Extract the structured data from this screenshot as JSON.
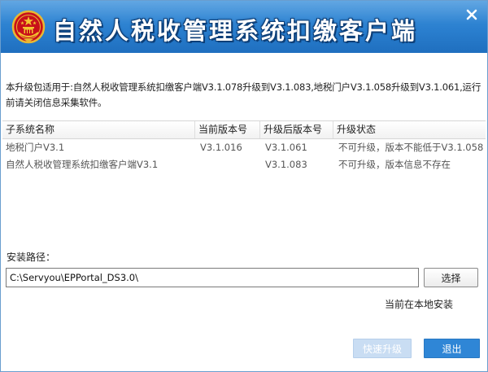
{
  "window": {
    "title": "自然人税收管理系统扣缴客户端",
    "close_symbol": "✕"
  },
  "description": "本升级包适用于:自然人税收管理系统扣缴客户端V3.1.078升级到V3.1.083,地税门户V3.1.058升级到V3.1.061,运行前请关闭信息采集软件。",
  "table": {
    "headers": [
      "子系统名称",
      "当前版本号",
      "升级后版本号",
      "升级状态"
    ],
    "rows": [
      {
        "name": "地税门户V3.1",
        "current": "V3.1.016",
        "target": "V3.1.061",
        "status": "不可升级，版本不能低于V3.1.058"
      },
      {
        "name": "自然人税收管理系统扣缴客户端V3.1",
        "current": "",
        "target": "V3.1.083",
        "status": "不可升级，版本信息不存在"
      }
    ]
  },
  "install": {
    "label": "安装路径：",
    "path_value": "C:\\Servyou\\EPPortal_DS3.0\\",
    "browse_label": "选择",
    "status_text": "当前在本地安装"
  },
  "buttons": {
    "upgrade_label": "快速升级",
    "exit_label": "退出"
  },
  "icons": {
    "emblem": "national-emblem-icon",
    "close": "close-icon"
  },
  "colors": {
    "title_bar": "#2a7fcf",
    "primary_button": "#2f86d6",
    "disabled_button": "#c9ddf3"
  }
}
